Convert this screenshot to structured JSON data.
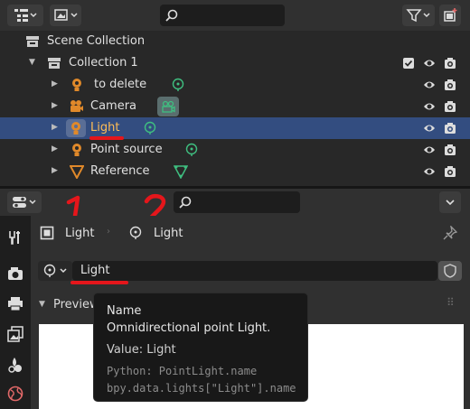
{
  "outliner": {
    "search_placeholder": "",
    "items": [
      {
        "label": "Scene Collection"
      },
      {
        "label": "Collection 1"
      },
      {
        "label": "to delete"
      },
      {
        "label": "Camera"
      },
      {
        "label": "Light"
      },
      {
        "label": "Point source"
      },
      {
        "label": "Reference"
      }
    ]
  },
  "annotations": {
    "one": "1",
    "two": "2"
  },
  "properties": {
    "breadcrumb": {
      "object": "Light",
      "data": "Light"
    },
    "datablock_name": "Light",
    "section": "Preview"
  },
  "tooltip": {
    "title": "Name",
    "description": "Omnidirectional point Light.",
    "value": "Value: Light",
    "python1": "Python: PointLight.name",
    "python2": "bpy.data.lights[\"Light\"].name"
  },
  "colors": {
    "selection": "#334d80",
    "annotation_red": "#e5161b",
    "light_orange": "#e0892a",
    "data_green": "#3fbf80"
  }
}
